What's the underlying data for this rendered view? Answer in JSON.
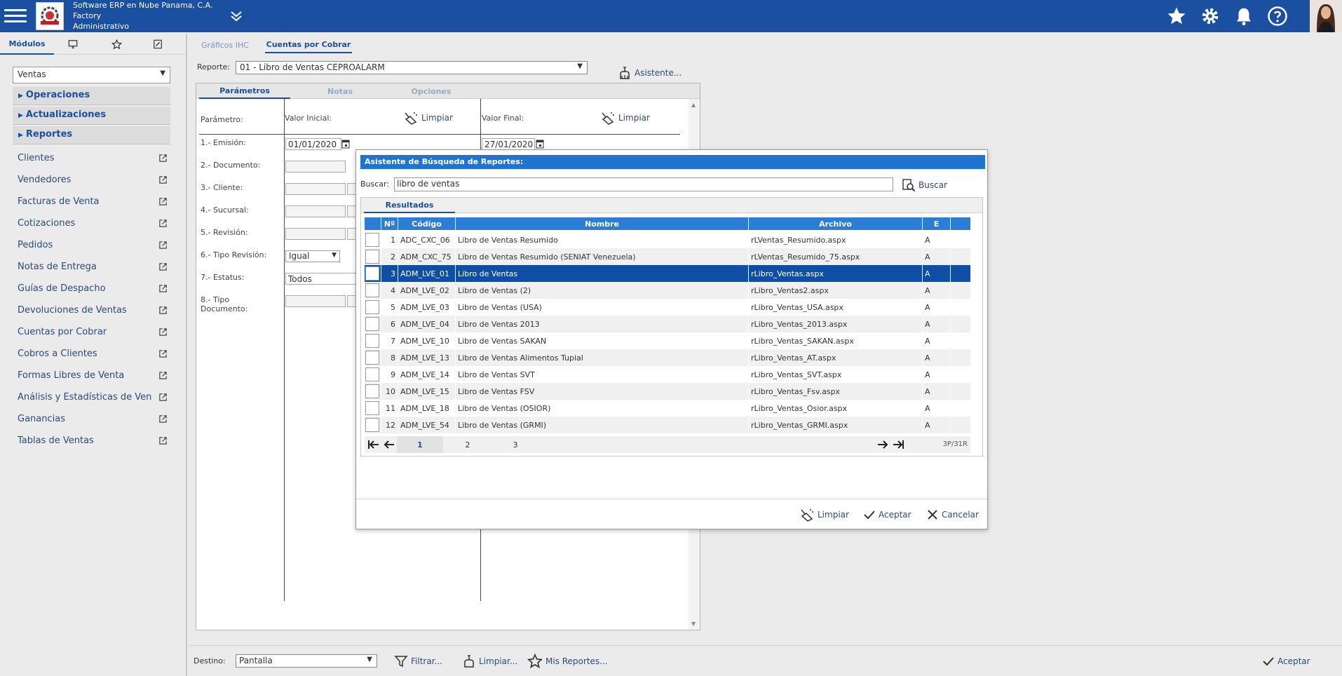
{
  "header": {
    "company_line1": "Software ERP en Nube Panama, C.A.",
    "company_line2": "Factory",
    "company_line3": "Administrativo",
    "brand_color": "#1b4fa0"
  },
  "left": {
    "tab_modulos": "Módulos",
    "module_value": "Ventas",
    "sections": [
      "Operaciones",
      "Actualizaciones",
      "Reportes"
    ],
    "items": [
      "Clientes",
      "Vendedores",
      "Facturas de Venta",
      "Cotizaciones",
      "Pedidos",
      "Notas de Entrega",
      "Guías de Despacho",
      "Devoluciones de Ventas",
      "Cuentas por Cobrar",
      "Cobros a Clientes",
      "Formas Libres de Venta",
      "Análisis y Estadísticas de Ven",
      "Ganancias",
      "Tablas de Ventas"
    ]
  },
  "main": {
    "tabs": [
      "Gráficos IHC",
      "Cuentas por Cobrar"
    ],
    "reporte_label": "Reporte:",
    "reporte_value": "01 - Libro de Ventas CEPROALARM",
    "asistente": "Asistente...",
    "param_tabs": [
      "Parámetros",
      "Notas",
      "Opciones"
    ],
    "col_parametro": "Parámetro:",
    "col_valor_inicial": "Valor Inicial:",
    "col_valor_final": "Valor Final:",
    "limpiar": "Limpiar",
    "params": [
      "1.- Emisión:",
      "2.- Documento:",
      "3.- Cliente:",
      "4.- Sucursal:",
      "5.- Revisión:",
      "6.- Tipo Revisión:",
      "7.- Estatus:",
      "8.- Tipo Documento:"
    ],
    "emision_inicial": "01/01/2020",
    "emision_final": "27/01/2020",
    "tipo_revision_value": "Igual",
    "estatus_value": "Todos"
  },
  "bottom": {
    "destino_label": "Destino:",
    "destino_value": "Pantalla",
    "filtrar": "Filtrar...",
    "limpiar": "Limpiar...",
    "mis_reportes": "Mis Reportes...",
    "aceptar": "Aceptar"
  },
  "dialog": {
    "title": "Asistente de Búsqueda de Reportes:",
    "buscar_label": "Buscar:",
    "search_value": "libro de ventas",
    "buscar_btn": "Buscar",
    "results_tab": "Resultados",
    "columns": [
      "Nº",
      "Código",
      "Nombre",
      "Archivo",
      "E"
    ],
    "rows": [
      {
        "n": "1",
        "codigo": "ADC_CXC_06",
        "nombre": "Libro de Ventas Resumido",
        "archivo": "rLVentas_Resumido.aspx",
        "e": "A"
      },
      {
        "n": "2",
        "codigo": "ADM_CXC_75",
        "nombre": "Libro de Ventas Resumido (SENIAT Venezuela)",
        "archivo": "rLVentas_Resumido_75.aspx",
        "e": "A"
      },
      {
        "n": "3",
        "codigo": "ADM_LVE_01",
        "nombre": "Libro de Ventas",
        "archivo": "rLibro_Ventas.aspx",
        "e": "A"
      },
      {
        "n": "4",
        "codigo": "ADM_LVE_02",
        "nombre": "Libro de Ventas (2)",
        "archivo": "rLibro_Ventas2.aspx",
        "e": "A"
      },
      {
        "n": "5",
        "codigo": "ADM_LVE_03",
        "nombre": "Libro de Ventas (USA)",
        "archivo": "rLibro_Ventas_USA.aspx",
        "e": "A"
      },
      {
        "n": "6",
        "codigo": "ADM_LVE_04",
        "nombre": "Libro de Ventas 2013",
        "archivo": "rLibro_Ventas_2013.aspx",
        "e": "A"
      },
      {
        "n": "7",
        "codigo": "ADM_LVE_10",
        "nombre": "Libro de Ventas SAKAN",
        "archivo": "rLibro_Ventas_SAKAN.aspx",
        "e": "A"
      },
      {
        "n": "8",
        "codigo": "ADM_LVE_13",
        "nombre": "Libro de Ventas Alimentos Tupial",
        "archivo": "rLibro_Ventas_AT.aspx",
        "e": "A"
      },
      {
        "n": "9",
        "codigo": "ADM_LVE_14",
        "nombre": "Libro de Ventas SVT",
        "archivo": "rLibro_Ventas_SVT.aspx",
        "e": "A"
      },
      {
        "n": "10",
        "codigo": "ADM_LVE_15",
        "nombre": "Libro de Ventas FSV",
        "archivo": "rLibro_Ventas_Fsv.aspx",
        "e": "A"
      },
      {
        "n": "11",
        "codigo": "ADM_LVE_18",
        "nombre": "Libro de Ventas (OSIOR)",
        "archivo": "rLibro_Ventas_Osior.aspx",
        "e": "A"
      },
      {
        "n": "12",
        "codigo": "ADM_LVE_54",
        "nombre": "Libro de Ventas (GRMI)",
        "archivo": "rLibro_Ventas_GRMI.aspx",
        "e": "A"
      }
    ],
    "selected_row": 3,
    "pages": [
      "1",
      "2",
      "3"
    ],
    "page_info": "3P/31R",
    "limpiar": "Limpiar",
    "aceptar": "Aceptar",
    "cancelar": "Cancelar"
  }
}
